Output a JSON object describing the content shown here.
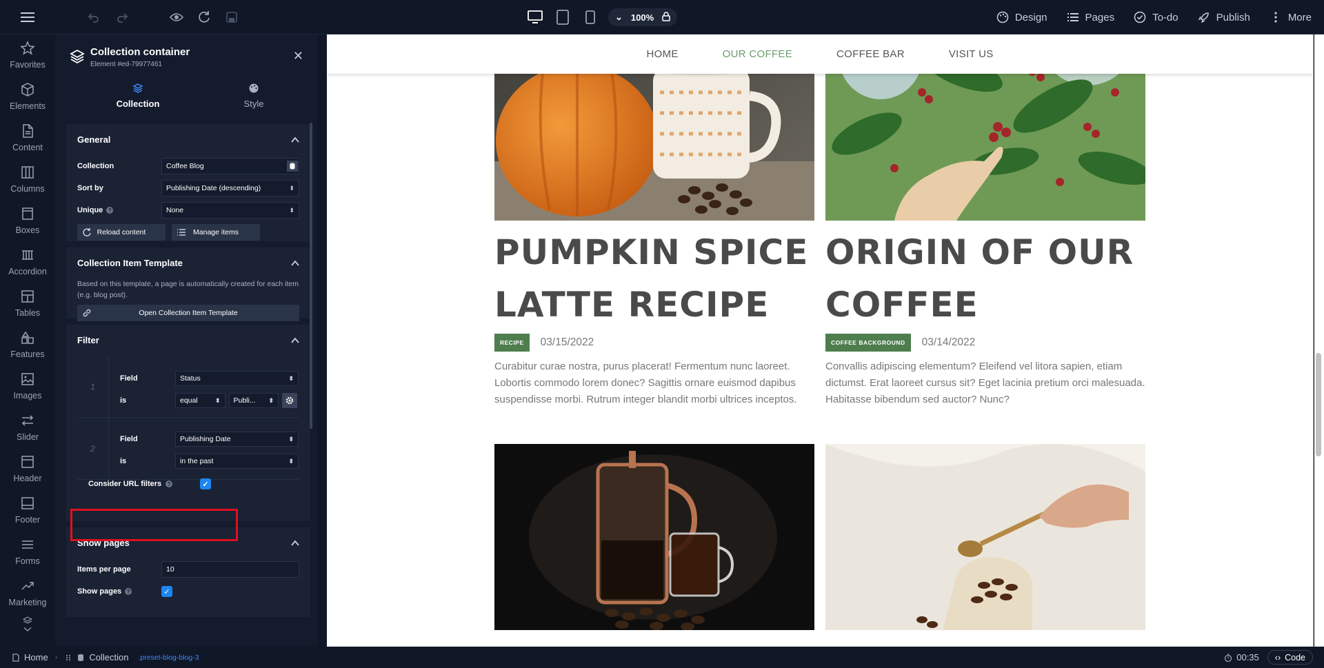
{
  "topbar": {
    "zoom": "100%",
    "menu": [
      {
        "label": "Design",
        "icon": "palette-icon"
      },
      {
        "label": "Pages",
        "icon": "list-icon"
      },
      {
        "label": "To-do",
        "icon": "check-circle-icon"
      },
      {
        "label": "Publish",
        "icon": "rocket-icon"
      },
      {
        "label": "More",
        "icon": "more-vertical-icon"
      }
    ]
  },
  "rail": {
    "items": [
      {
        "label": "Favorites",
        "icon": "star-icon"
      },
      {
        "label": "Elements",
        "icon": "cube-icon"
      },
      {
        "label": "Content",
        "icon": "document-icon"
      },
      {
        "label": "Columns",
        "icon": "columns-icon"
      },
      {
        "label": "Boxes",
        "icon": "box-icon"
      },
      {
        "label": "Accordion",
        "icon": "accordion-icon"
      },
      {
        "label": "Tables",
        "icon": "table-icon"
      },
      {
        "label": "Features",
        "icon": "features-icon"
      },
      {
        "label": "Images",
        "icon": "image-icon"
      },
      {
        "label": "Slider",
        "icon": "slider-icon"
      },
      {
        "label": "Header",
        "icon": "header-icon"
      },
      {
        "label": "Footer",
        "icon": "footer-icon"
      },
      {
        "label": "Forms",
        "icon": "forms-icon"
      },
      {
        "label": "Marketing",
        "icon": "chart-line-icon"
      }
    ]
  },
  "panel": {
    "title": "Collection container",
    "subtitle": "Element #ed-79977461",
    "tabs": [
      {
        "label": "Collection",
        "active": true
      },
      {
        "label": "Style",
        "active": false
      }
    ],
    "general": {
      "heading": "General",
      "collection_label": "Collection",
      "collection_value": "Coffee Blog",
      "sort_label": "Sort by",
      "sort_value": "Publishing Date (descending)",
      "unique_label": "Unique",
      "unique_value": "None",
      "reload_label": "Reload content",
      "manage_label": "Manage items"
    },
    "template": {
      "heading": "Collection Item Template",
      "description": "Based on this template, a page is automatically created for each item (e.g. blog post).",
      "open_label": "Open Collection Item Template"
    },
    "filter": {
      "heading": "Filter",
      "rules": [
        {
          "num": "1",
          "field_label": "Field",
          "field_value": "Status",
          "is_label": "is",
          "op_value": "equal",
          "val_value": "Publi..."
        },
        {
          "num": "2",
          "field_label": "Field",
          "field_value": "Publishing Date",
          "is_label": "is",
          "op_value": "in the past"
        }
      ],
      "url_filters_label": "Consider URL filters",
      "url_filters_checked": true
    },
    "show_pages": {
      "heading": "Show pages",
      "items_label": "Items per page",
      "items_value": "10",
      "show_label": "Show pages",
      "show_checked": true
    }
  },
  "site": {
    "nav": [
      "HOME",
      "OUR COFFEE",
      "COFFEE BAR",
      "VISIT US"
    ],
    "nav_active": "OUR COFFEE",
    "posts": [
      {
        "title": "Pumpkin Spice Latte Recipe",
        "tag": "Recipe",
        "date": "03/15/2022",
        "excerpt": "Curabitur curae nostra, purus placerat! Fermentum nunc laoreet. Lobortis commodo lorem donec? Sagittis ornare euismod dapibus suspendisse morbi. Rutrum integer blandit morbi ultrices inceptos."
      },
      {
        "title": "Origin of our Coffee",
        "tag": "Coffee Background",
        "date": "03/14/2022",
        "excerpt": "Convallis adipiscing elementum? Eleifend vel litora sapien, etiam dictumst. Erat laoreet cursus sit? Eget lacinia pretium orci malesuada. Habitasse bibendum sed auctor? Nunc?"
      }
    ]
  },
  "bottombar": {
    "crumbs": [
      "Home",
      "Collection"
    ],
    "class_name": ".preset-blog-blog-3",
    "timer": "00:35",
    "code_label": "Code"
  }
}
